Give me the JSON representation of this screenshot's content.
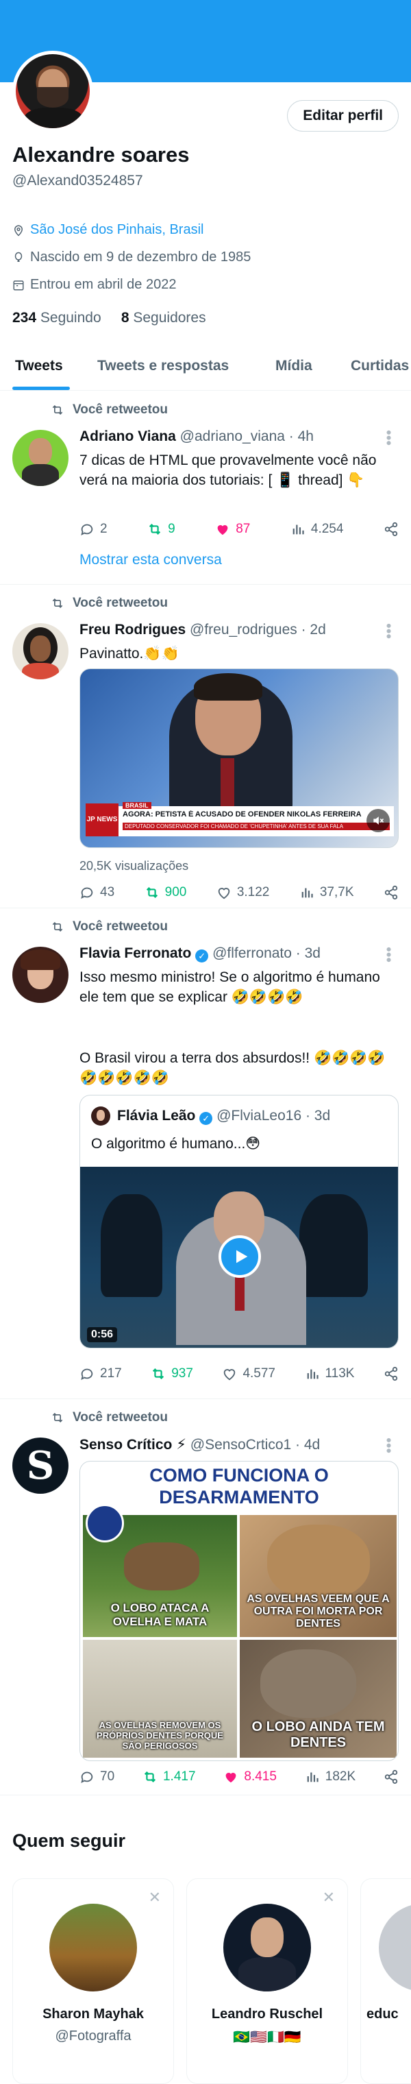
{
  "profile": {
    "name": "Alexandre soares",
    "handle": "@Alexand03524857",
    "edit_label": "Editar perfil",
    "location": "São José dos Pinhais, Brasil",
    "born": "Nascido em 9 de dezembro de 1985",
    "joined": "Entrou em abril de 2022",
    "following_count": "234",
    "following_label": "Seguindo",
    "followers_count": "8",
    "followers_label": "Seguidores"
  },
  "tabs": [
    "Tweets",
    "Tweets e respostas",
    "Mídia",
    "Curtidas"
  ],
  "retweet_label": "Você retweetou",
  "tweets": [
    {
      "name": "Adriano Viana",
      "handle": "@adriano_viana · 4h",
      "text": "7 dicas de HTML que provavelmente você não verá na maioria dos tutoriais: [ 📱 thread] 👇",
      "replies": "2",
      "retweets": "9",
      "likes": "87",
      "views": "4.254",
      "show_conversation": "Mostrar esta conversa"
    },
    {
      "name": "Freu Rodrigues",
      "handle": "@freu_rodrigues · 2d",
      "text": "Pavinatto.👏👏",
      "media_banner": "AGORA: PETISTA É ACUSADO DE OFENDER NIKOLAS FERREIRA",
      "media_subbanner": "DEPUTADO CONSERVADOR FOI CHAMADO DE 'CHUPETINHA' ANTES DE SUA FALA",
      "media_tag": "BRASIL",
      "media_logo": "JP NEWS",
      "views_text": "20,5K visualizações",
      "replies": "43",
      "retweets": "900",
      "likes": "3.122",
      "views": "37,7K"
    },
    {
      "name": "Flavia Ferronato",
      "handle": "@flferronato · 3d",
      "text": "Isso mesmo ministro! Se o algoritmo é humano ele tem que se explicar 🤣🤣🤣🤣",
      "text2": "O Brasil virou a terra dos absurdos!! 🤣🤣🤣🤣🤣🤣🤣🤣🤣",
      "quote_name": "Flávia Leão",
      "quote_handle": "@FlviaLeo16 · 3d",
      "quote_text": "O algoritmo é humano...😳",
      "video_time": "0:56",
      "replies": "217",
      "retweets": "937",
      "likes": "4.577",
      "views": "113K"
    },
    {
      "name": "Senso Crítico ⚡",
      "handle": "@SensoCrtico1 · 4d",
      "image_title": "COMO FUNCIONA O DESARMAMENTO",
      "panel1": "O LOBO ATACA A OVELHA E MATA",
      "panel2": "AS OVELHAS VEEM QUE A OUTRA FOI MORTA POR DENTES",
      "panel3": "AS OVELHAS REMOVEM OS PRÓPRIOS DENTES PORQUE SÃO PERIGOSOS",
      "panel4": "O LOBO AINDA TEM DENTES",
      "replies": "70",
      "retweets": "1.417",
      "likes": "8.415",
      "views": "182K"
    }
  ],
  "who_to_follow": {
    "title": "Quem seguir",
    "cards": [
      {
        "name": "Sharon Mayhak",
        "handle": "@Fotograffa"
      },
      {
        "name": "Leandro Ruschel",
        "handle": "🇧🇷🇺🇸🇮🇹🇩🇪"
      },
      {
        "name": "educ",
        "handle": ""
      }
    ]
  },
  "colors": {
    "accent": "#1d9bf0",
    "retweet": "#00ba7c",
    "like": "#f91880",
    "muted": "#536471"
  }
}
